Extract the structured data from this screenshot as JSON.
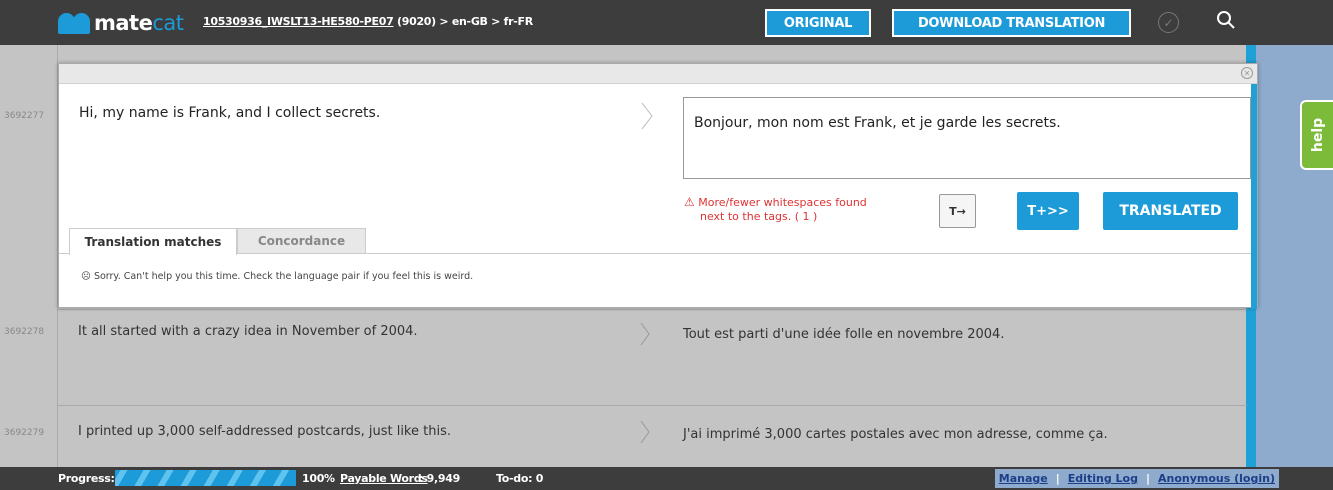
{
  "header": {
    "logo_main": "mate",
    "logo_accent": "cat",
    "project_id": "10530936_IWSLT13-HE580-PE07",
    "project_info": "(9020) > en-GB > fr-FR",
    "original_button": "ORIGINAL",
    "download_button": "DOWNLOAD TRANSLATION",
    "check_icon": "check-circle-icon",
    "search_icon": "search-icon"
  },
  "help_tab": "help",
  "segments": [
    {
      "id": "3692277",
      "source": "Hi, my name is Frank, and I collect secrets.",
      "target": "Bonjour, mon nom est Frank, et je garde les secrets."
    },
    {
      "id": "3692278",
      "source": "It all started with a crazy idea in November of 2004.",
      "target": "Tout est parti d'une idée folle en novembre 2004."
    },
    {
      "id": "3692279",
      "source": "I printed up 3,000 self-addressed postcards, just like this.",
      "target": "J'ai imprimé 3,000 cartes postales avec mon adresse, comme ça."
    }
  ],
  "active_segment": {
    "warning_icon": "warning-triangle-icon",
    "warning_line1": "More/fewer whitespaces found",
    "warning_line2": "next to the tags. ( 1 )",
    "tag_button": "T→",
    "copy_button": "T+>>",
    "translated_button": "TRANSLATED",
    "tabs": {
      "matches": "Translation matches",
      "concordance": "Concordance"
    },
    "no_matches": "Sorry. Can't help you this time. Check the language pair if you feel this is weird."
  },
  "footer": {
    "progress_label": "Progress:",
    "progress_percent": "100%",
    "progress_value": 1.0,
    "payable_label": "Payable Words",
    "payable_value": ": 9,949",
    "todo": "To-do: 0",
    "manage": "Manage",
    "editing_log": "Editing Log",
    "user": "Anonymous (login)"
  },
  "colors": {
    "accent": "#1d9bd8",
    "header_bg": "#3d3d3d",
    "help": "#7cbb3a",
    "warning": "#d33333"
  }
}
